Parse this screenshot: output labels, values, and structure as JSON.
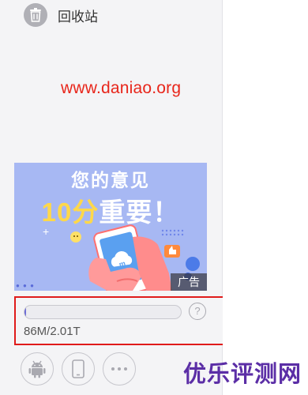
{
  "sidebar": {
    "recycle_bin": {
      "label": "回收站",
      "icon": "trash-icon"
    }
  },
  "watermark": {
    "url_text": "www.daniao.org",
    "color": "#e8261b"
  },
  "ad": {
    "headline_line1": "您的意见",
    "headline_line2_highlight": "10分",
    "headline_line2_rest": "重要！",
    "badge": "广告",
    "background": "#a7b8f3"
  },
  "quota": {
    "used_fraction": 0.005,
    "text": "86M/2.01T",
    "help_icon": "question-icon",
    "highlight_color": "#e01b1b"
  },
  "bottom_icons": [
    "android-icon",
    "phone-icon",
    "more-icon"
  ],
  "site_brand": {
    "text": "优乐评测网",
    "color": "#5b2ea6"
  }
}
